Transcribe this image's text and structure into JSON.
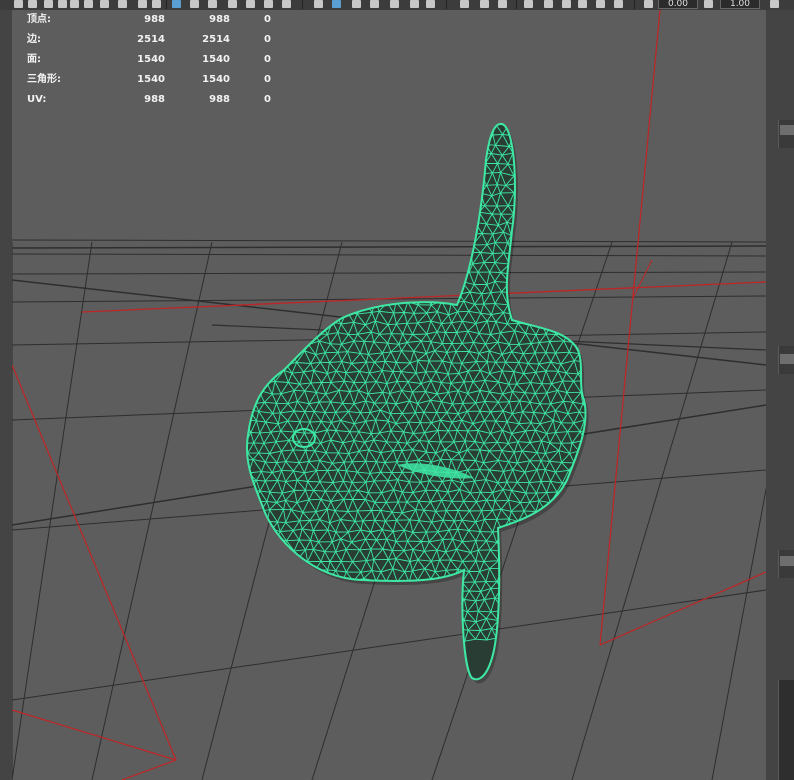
{
  "toolbar": {
    "field_1": "0.00",
    "field_2": "1.00"
  },
  "hud": {
    "rows": [
      {
        "label": "顶点:",
        "selected": "988",
        "total": "988",
        "extra": "0"
      },
      {
        "label": "边:",
        "selected": "2514",
        "total": "2514",
        "extra": "0"
      },
      {
        "label": "面:",
        "selected": "1540",
        "total": "1540",
        "extra": "0"
      },
      {
        "label": "三角形:",
        "selected": "1540",
        "total": "1540",
        "extra": "0"
      },
      {
        "label": "UV:",
        "selected": "988",
        "total": "988",
        "extra": "0"
      }
    ]
  },
  "viewport": {
    "background_color": "#5d5d5d",
    "grid_color": "#2e2e2e",
    "axis_color": "#c02525",
    "wireframe_color": "#3ee8a4",
    "mesh_fill_color": "#2a3d35",
    "model": "sunfish"
  }
}
